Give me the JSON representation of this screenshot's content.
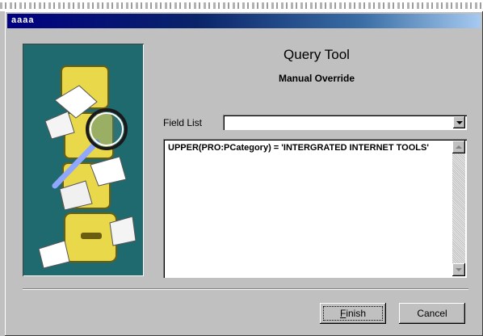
{
  "window": {
    "title": "aaaa"
  },
  "header": {
    "title": "Query Tool",
    "subtitle": "Manual Override"
  },
  "field_list": {
    "label": "Field List",
    "value": ""
  },
  "query": {
    "text": "UPPER(PRO:PCategory) = 'INTERGRATED INTERNET TOOLS'"
  },
  "buttons": {
    "finish_first": "F",
    "finish_rest": "inish",
    "cancel": "Cancel"
  },
  "colors": {
    "title_bar": "#000080",
    "illustration_bg": "#1f6a6e",
    "face": "#c0c0c0"
  }
}
